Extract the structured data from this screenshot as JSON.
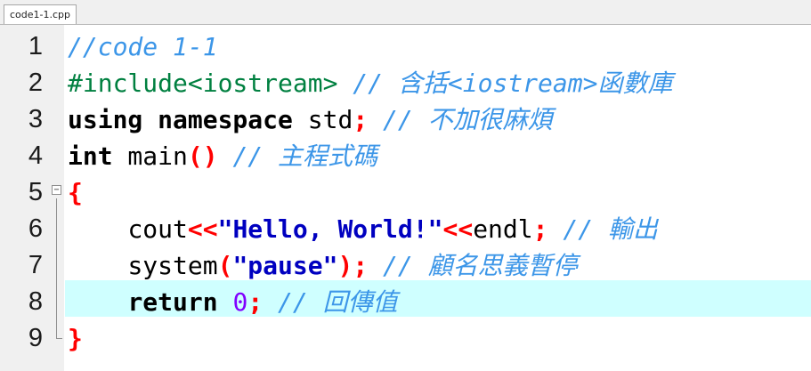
{
  "tab": {
    "title": "code1-1.cpp"
  },
  "line_numbers": [
    "1",
    "2",
    "3",
    "4",
    "5",
    "6",
    "7",
    "8",
    "9"
  ],
  "code": {
    "l1": {
      "comment": "//code 1-1"
    },
    "l2": {
      "directive": "#include<iostream>",
      "comment": " // 含括<iostream>函數庫"
    },
    "l3": {
      "kw": "using namespace",
      "rest": " std",
      "semi": ";",
      "comment": " // 不加很麻煩"
    },
    "l4": {
      "kw": "int",
      "name": " main",
      "parens": "()",
      "comment": " // 主程式碼"
    },
    "l5": {
      "brace": "{"
    },
    "l6": {
      "indent": "    ",
      "id": "cout",
      "op1": "<<",
      "str": "\"Hello, World!\"",
      "op2": "<<",
      "id2": "endl",
      "semi": ";",
      "comment": " // 輸出"
    },
    "l7": {
      "indent": "    ",
      "id": "system",
      "p1": "(",
      "str": "\"pause\"",
      "p2": ")",
      "semi": ";",
      "comment": " // 顧名思義暫停"
    },
    "l8": {
      "indent": "    ",
      "kw": "return",
      "sp": " ",
      "num": "0",
      "semi": ";",
      "comment": " // 回傳值"
    },
    "l9": {
      "brace": "}"
    }
  },
  "colors": {
    "highlight": "#cfffff",
    "comment": "#3c96e8",
    "preprocessor": "#008040",
    "operator": "#ff0000",
    "string": "#0000c0",
    "number": "#8000ff"
  }
}
